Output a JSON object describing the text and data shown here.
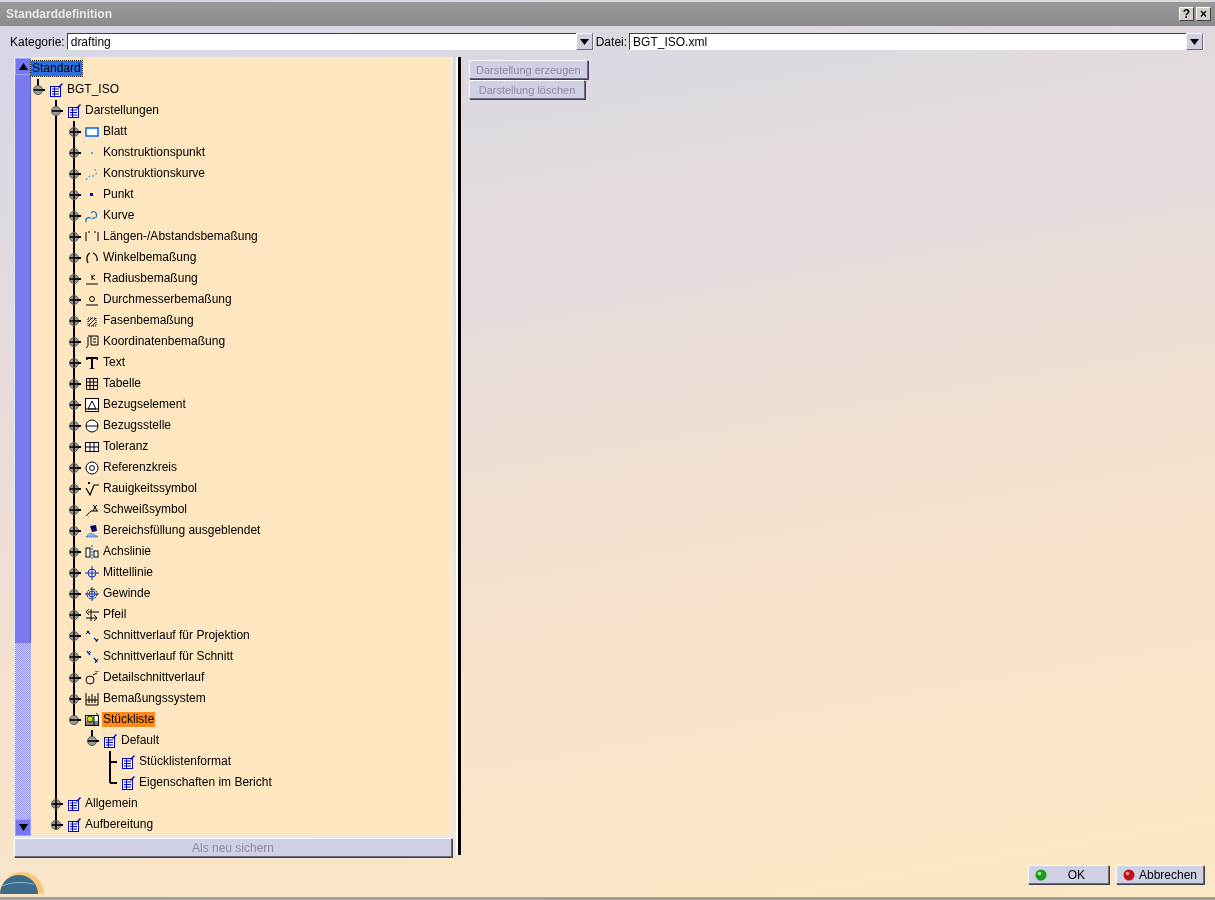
{
  "window": {
    "title": "Standarddefinition",
    "title_buttons": [
      "?",
      "×"
    ]
  },
  "kategorie": {
    "label": "Kategorie:",
    "value": "drafting"
  },
  "datei": {
    "label": "Datei:",
    "value": "BGT_ISO.xml"
  },
  "tree": {
    "nodes": [
      {
        "label": "Standard",
        "selected": false,
        "focused": true,
        "children": [
          {
            "label": "BGT_ISO",
            "selected": false,
            "focused": false,
            "expanded": true,
            "children": [
              {
                "label": "Darstellungen",
                "selected": false,
                "focused": false,
                "expanded": true,
                "children": [
                  {
                    "label": "Blatt",
                    "selected": false,
                    "focused": false,
                    "expanded": false
                  },
                  {
                    "label": "Konstruktionspunkt",
                    "selected": false,
                    "focused": false,
                    "expanded": false
                  },
                  {
                    "label": "Konstruktionskurve",
                    "selected": false,
                    "focused": false,
                    "expanded": false
                  },
                  {
                    "label": "Punkt",
                    "selected": false,
                    "focused": false,
                    "expanded": false
                  },
                  {
                    "label": "Kurve",
                    "selected": false,
                    "focused": false,
                    "expanded": false
                  },
                  {
                    "label": "Längen-/Abstandsbemaßung",
                    "selected": false,
                    "focused": false,
                    "expanded": false
                  },
                  {
                    "label": "Winkelbemaßung",
                    "selected": false,
                    "focused": false,
                    "expanded": false
                  },
                  {
                    "label": "Radiusbemaßung",
                    "selected": false,
                    "focused": false,
                    "expanded": false
                  },
                  {
                    "label": "Durchmesserbemaßung",
                    "selected": false,
                    "focused": false,
                    "expanded": false
                  },
                  {
                    "label": "Fasenbemaßung",
                    "selected": false,
                    "focused": false,
                    "expanded": false
                  },
                  {
                    "label": "Koordinatenbemaßung",
                    "selected": false,
                    "focused": false,
                    "expanded": false
                  },
                  {
                    "label": "Text",
                    "selected": false,
                    "focused": false,
                    "expanded": false
                  },
                  {
                    "label": "Tabelle",
                    "selected": false,
                    "focused": false,
                    "expanded": false
                  },
                  {
                    "label": "Bezugselement",
                    "selected": false,
                    "focused": false,
                    "expanded": false
                  },
                  {
                    "label": "Bezugsstelle",
                    "selected": false,
                    "focused": false,
                    "expanded": false
                  },
                  {
                    "label": "Toleranz",
                    "selected": false,
                    "focused": false,
                    "expanded": false
                  },
                  {
                    "label": "Referenzkreis",
                    "selected": false,
                    "focused": false,
                    "expanded": false
                  },
                  {
                    "label": "Rauigkeitssymbol",
                    "selected": false,
                    "focused": false,
                    "expanded": false
                  },
                  {
                    "label": "Schweißsymbol",
                    "selected": false,
                    "focused": false,
                    "expanded": false
                  },
                  {
                    "label": "Bereichsfüllung ausgeblendet",
                    "selected": false,
                    "focused": false,
                    "expanded": false
                  },
                  {
                    "label": "Achslinie",
                    "selected": false,
                    "focused": false,
                    "expanded": false
                  },
                  {
                    "label": "Mittellinie",
                    "selected": false,
                    "focused": false,
                    "expanded": false
                  },
                  {
                    "label": "Gewinde",
                    "selected": false,
                    "focused": false,
                    "expanded": false
                  },
                  {
                    "label": "Pfeil",
                    "selected": false,
                    "focused": false,
                    "expanded": false
                  },
                  {
                    "label": "Schnittverlauf für Projektion",
                    "selected": false,
                    "focused": false,
                    "expanded": false
                  },
                  {
                    "label": "Schnittverlauf für Schnitt",
                    "selected": false,
                    "focused": false,
                    "expanded": false
                  },
                  {
                    "label": "Detailschnittverlauf",
                    "selected": false,
                    "focused": false,
                    "expanded": false
                  },
                  {
                    "label": "Bemaßungssystem",
                    "selected": false,
                    "focused": false,
                    "expanded": false
                  },
                  {
                    "label": "Stückliste",
                    "selected": true,
                    "focused": false,
                    "expanded": true,
                    "children": [
                      {
                        "label": "Default",
                        "selected": false,
                        "focused": false,
                        "expanded": true,
                        "children": [
                          {
                            "label": "Stücklistenformat",
                            "selected": false,
                            "focused": false
                          },
                          {
                            "label": "Eigenschaften im Bericht",
                            "selected": false,
                            "focused": false
                          }
                        ]
                      }
                    ]
                  }
                ]
              },
              {
                "label": "Allgemein",
                "selected": false,
                "focused": false,
                "expanded": false
              },
              {
                "label": "Aufbereitung",
                "selected": false,
                "focused": false,
                "expanded": false
              }
            ]
          }
        ]
      }
    ]
  },
  "save_button": {
    "label": "Als neu sichern",
    "disabled": true
  },
  "side_buttons": [
    {
      "label": "Darstellung erzeugen",
      "disabled": true
    },
    {
      "label": "Darstellung löschen",
      "disabled": true
    }
  ],
  "footer_buttons": [
    {
      "label": "OK",
      "kind": "ok"
    },
    {
      "label": "Abbrechen",
      "kind": "cancel"
    }
  ]
}
